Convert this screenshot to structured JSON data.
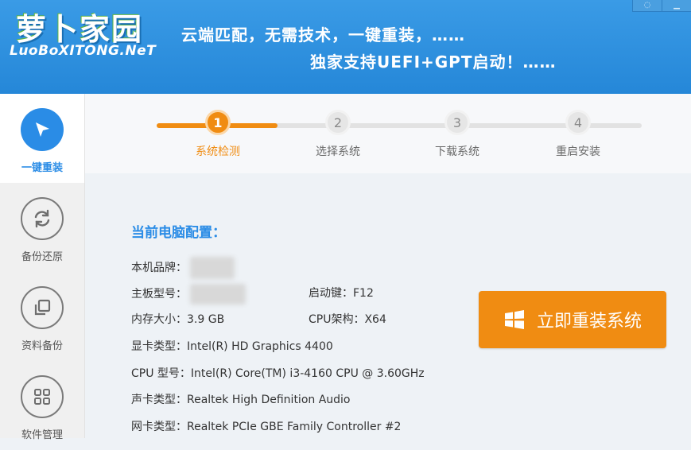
{
  "header": {
    "logo_main": "萝卜家园",
    "logo_sub": "LuoBoXITONG.NeT",
    "slogan_line1": "云端匹配，无需技术，一键重装，……",
    "slogan_line2": "独家支持UEFI+GPT启动！……",
    "background_color": "#2587d8"
  },
  "sidebar": {
    "items": [
      {
        "label": "一键重装",
        "icon": "cursor-arrow-icon",
        "active": true
      },
      {
        "label": "备份还原",
        "icon": "refresh-arrows-icon",
        "active": false
      },
      {
        "label": "资料备份",
        "icon": "copy-squares-icon",
        "active": false
      },
      {
        "label": "软件管理",
        "icon": "grid-squares-icon",
        "active": false
      }
    ]
  },
  "steps": [
    {
      "number": "1",
      "label": "系统检测",
      "active": true
    },
    {
      "number": "2",
      "label": "选择系统",
      "active": false
    },
    {
      "number": "3",
      "label": "下载系统",
      "active": false
    },
    {
      "number": "4",
      "label": "重启安装",
      "active": false
    }
  ],
  "config": {
    "title": "当前电脑配置：",
    "brand_label": "本机品牌：",
    "board_label": "主板型号：",
    "boot_key_label": "启动键：",
    "boot_key_value": "F12",
    "memory_label": "内存大小：",
    "memory_value": "3.9 GB",
    "cpu_arch_label": "CPU架构：",
    "cpu_arch_value": "X64",
    "gpu_label": "显卡类型：",
    "gpu_value": "Intel(R) HD Graphics 4400",
    "cpu_label": "CPU 型号：",
    "cpu_value": "Intel(R) Core(TM) i3-4160 CPU @ 3.60GHz",
    "audio_label": "声卡类型：",
    "audio_value": "Realtek High Definition Audio",
    "nic_label": "网卡类型：",
    "nic_value": "Realtek PCIe GBE Family Controller #2"
  },
  "action": {
    "reinstall_label": "立即重装系统",
    "accent_color": "#f08c12"
  },
  "colors": {
    "primary_blue": "#2a8ce6",
    "accent_orange": "#f08c12"
  }
}
